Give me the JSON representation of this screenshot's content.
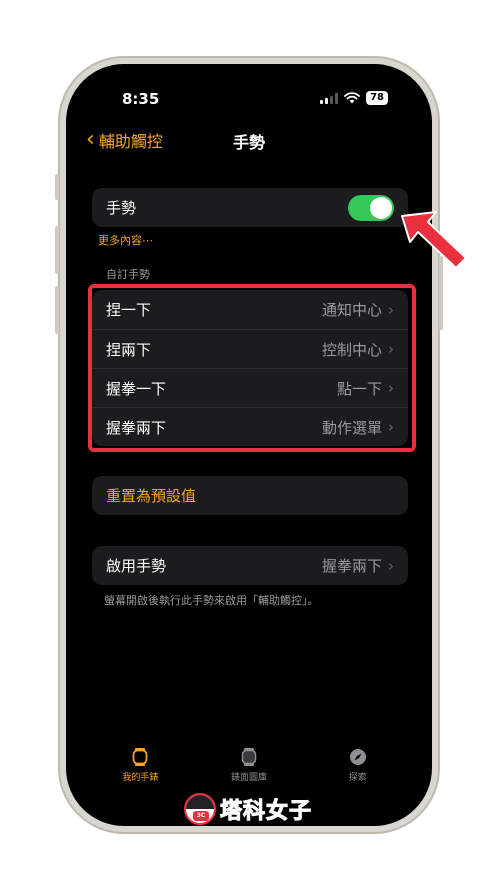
{
  "status_bar": {
    "time": "8:35",
    "battery": "78"
  },
  "nav": {
    "back_label": "輔助觸控",
    "title": "手勢"
  },
  "gesture_toggle": {
    "label": "手勢",
    "enabled": true
  },
  "more_link": "更多內容⋯",
  "custom_section": {
    "header": "自訂手勢",
    "rows": [
      {
        "label": "捏一下",
        "value": "通知中心"
      },
      {
        "label": "捏兩下",
        "value": "控制中心"
      },
      {
        "label": "握拳一下",
        "value": "點一下"
      },
      {
        "label": "握拳兩下",
        "value": "動作選單"
      }
    ]
  },
  "reset_label": "重置為預設值",
  "activation": {
    "label": "啟用手勢",
    "value": "握拳兩下",
    "note": "螢幕開啟後執行此手勢來啟用「輔助觸控」。"
  },
  "tabbar": {
    "tabs": [
      {
        "label": "我的手錶",
        "icon": "watch-icon",
        "active": true
      },
      {
        "label": "錶面圖庫",
        "icon": "watch-face-icon",
        "active": false
      },
      {
        "label": "探索",
        "icon": "compass-icon",
        "active": false
      }
    ]
  },
  "watermark": {
    "text": "塔科女子",
    "badge": "3C"
  },
  "colors": {
    "accent": "#f5a623",
    "toggle_on": "#34c759",
    "highlight": "#e8303f"
  }
}
